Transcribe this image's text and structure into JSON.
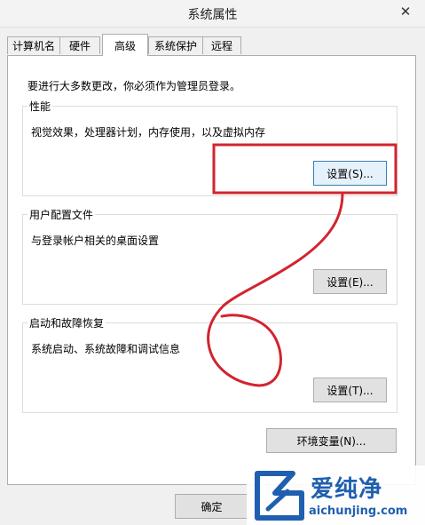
{
  "window": {
    "title": "系统属性",
    "close_glyph": "✕"
  },
  "tabs": [
    {
      "label": "计算机名",
      "active": false
    },
    {
      "label": "硬件",
      "active": false
    },
    {
      "label": "高级",
      "active": true
    },
    {
      "label": "系统保护",
      "active": false
    },
    {
      "label": "远程",
      "active": false
    }
  ],
  "notice": "要进行大多数更改，你必须作为管理员登录。",
  "performance": {
    "legend": "性能",
    "description": "视觉效果，处理器计划，内存使用，以及虚拟内存",
    "button": "设置(S)..."
  },
  "user_profile": {
    "legend": "用户配置文件",
    "description": "与登录帐户相关的桌面设置",
    "button": "设置(E)..."
  },
  "startup_recovery": {
    "legend": "启动和故障恢复",
    "description": "系统启动、系统故障和调试信息",
    "button": "设置(T)..."
  },
  "env_button": "环境变量(N)...",
  "ok_button": "确定",
  "watermark": {
    "brand": "爱纯净",
    "url": "aichunjing.com"
  },
  "colors": {
    "annotation_red": "#d2242f",
    "watermark_blue": "#1f5fb0"
  }
}
